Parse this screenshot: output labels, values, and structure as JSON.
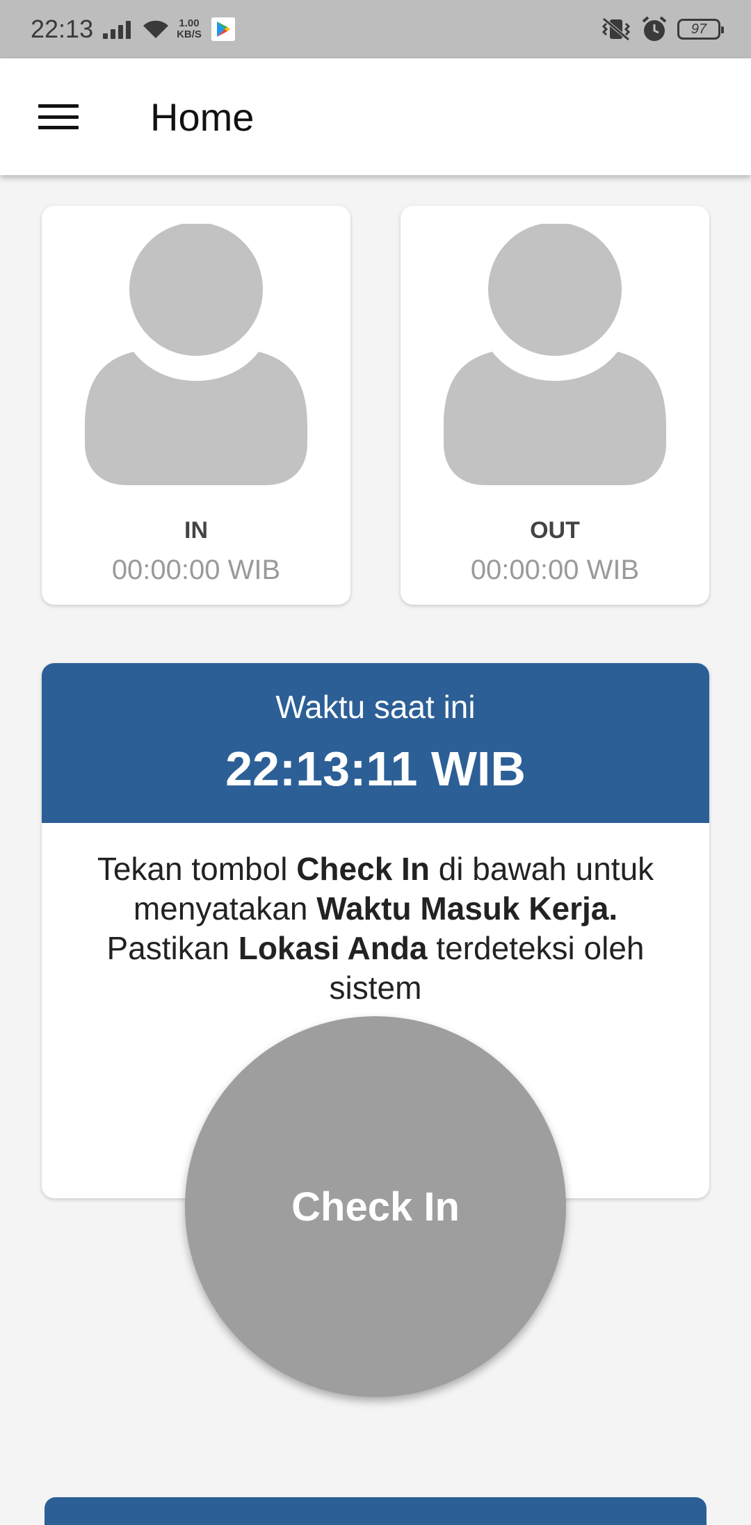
{
  "status_bar": {
    "time": "22:13",
    "net_speed_value": "1.00",
    "net_speed_unit": "KB/S",
    "battery": "97",
    "icons": [
      "signal-icon",
      "wifi-icon",
      "play-store-icon",
      "vibrate-icon",
      "alarm-icon",
      "battery-icon"
    ]
  },
  "app_bar": {
    "title": "Home",
    "menu_icon": "hamburger-menu-icon"
  },
  "attendance": {
    "in": {
      "label": "IN",
      "time": "00:00:00 WIB"
    },
    "out": {
      "label": "OUT",
      "time": "00:00:00 WIB"
    }
  },
  "clock": {
    "caption": "Waktu saat ini",
    "time": "22:13:11 WIB"
  },
  "instruction": {
    "t1": "Tekan tombol ",
    "b1": "Check In",
    "t2": " di bawah untuk menyatakan ",
    "b2": "Waktu Masuk Kerja.",
    "t3": " Pastikan ",
    "b3": "Lokasi Anda",
    "t4": " terdeteksi oleh sistem"
  },
  "checkin_button": {
    "label": "Check In"
  },
  "colors": {
    "primary": "#2c5f96",
    "button_disabled": "#9e9e9e",
    "avatar_placeholder": "#c2c2c2"
  }
}
